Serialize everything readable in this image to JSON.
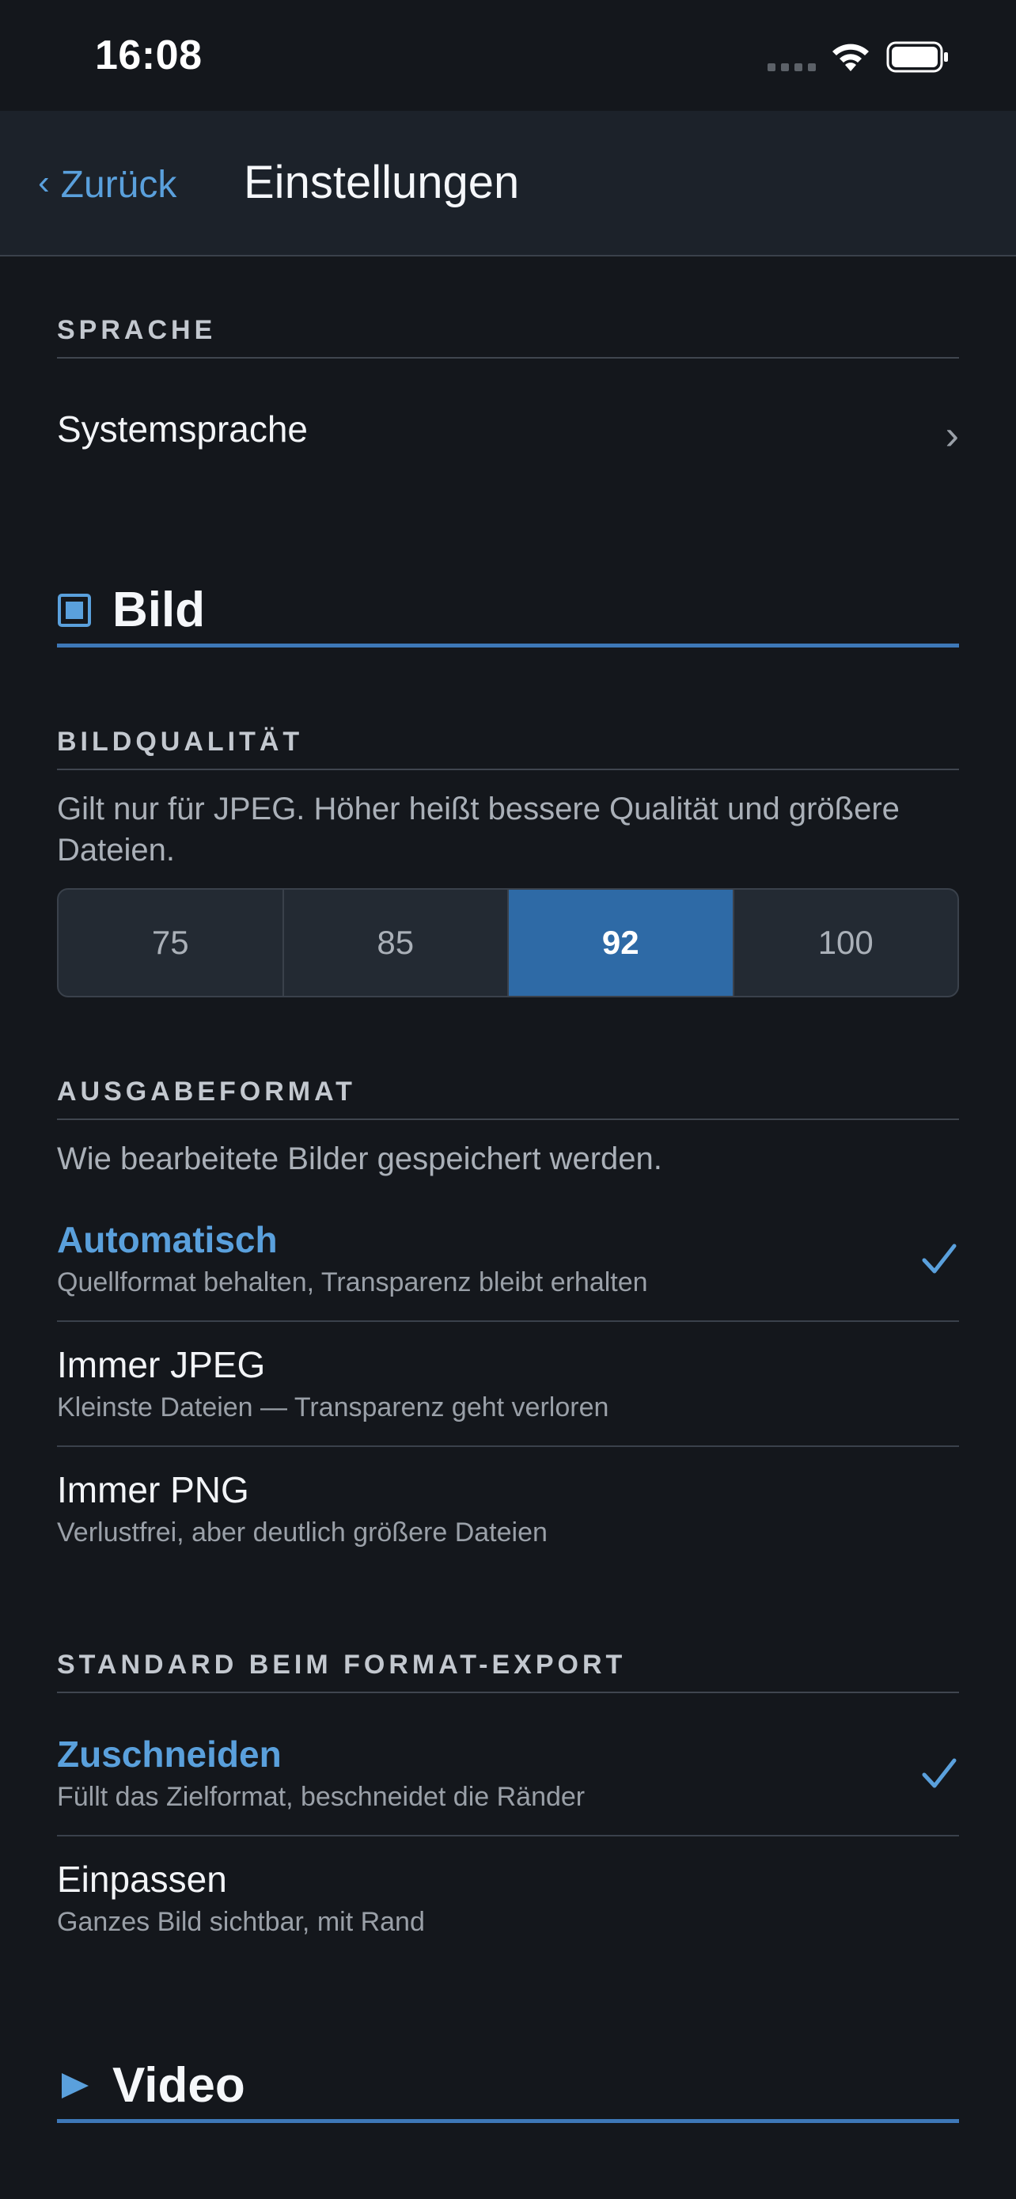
{
  "status": {
    "time": "16:08"
  },
  "nav": {
    "back_label": "Zurück",
    "title": "Einstellungen"
  },
  "language": {
    "header": "SPRACHE",
    "value": "Systemsprache"
  },
  "image_group": {
    "icon": "square-icon",
    "title": "Bild"
  },
  "quality": {
    "header": "BILDQUALITÄT",
    "description": "Gilt nur für JPEG. Höher heißt bessere Qualität und größere Dateien.",
    "options": [
      "75",
      "85",
      "92",
      "100"
    ],
    "selected": "92"
  },
  "output_format": {
    "header": "AUSGABEFORMAT",
    "description": "Wie bearbeitete Bilder gespeichert werden.",
    "options": [
      {
        "title": "Automatisch",
        "subtitle": "Quellformat behalten, Transparenz bleibt erhalten",
        "selected": true
      },
      {
        "title": "Immer JPEG",
        "subtitle": "Kleinste Dateien — Transparenz geht verloren",
        "selected": false
      },
      {
        "title": "Immer PNG",
        "subtitle": "Verlustfrei, aber deutlich größere Dateien",
        "selected": false
      }
    ]
  },
  "format_export": {
    "header": "STANDARD BEIM FORMAT-EXPORT",
    "options": [
      {
        "title": "Zuschneiden",
        "subtitle": "Füllt das Zielformat, beschneidet die Ränder",
        "selected": true
      },
      {
        "title": "Einpassen",
        "subtitle": "Ganzes Bild sichtbar, mit Rand",
        "selected": false
      }
    ]
  },
  "video_group": {
    "icon": "play-triangle-icon",
    "title": "Video"
  },
  "colors": {
    "accent": "#5aa0dc",
    "segment_active": "#2e6aa6",
    "background": "#14171c",
    "navbar": "#1c222a"
  }
}
